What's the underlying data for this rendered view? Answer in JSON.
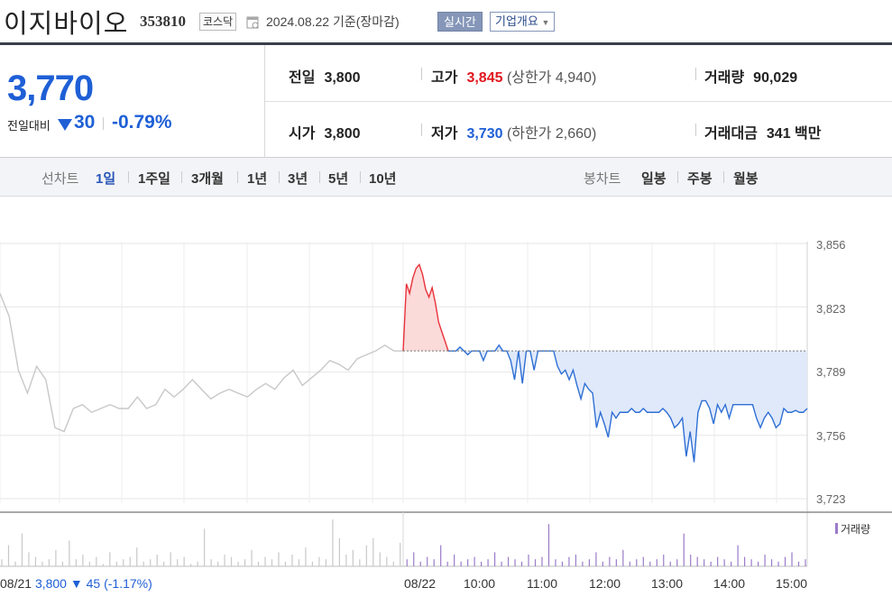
{
  "header": {
    "stock_name": "이지바이오",
    "stock_code": "353810",
    "market": "코스닥",
    "date": "2024.08.22",
    "date_suffix": "기준(장마감)",
    "realtime_label": "실시간",
    "company_info_label": "기업개요"
  },
  "quote": {
    "price": "3,770",
    "change_label": "전일대비",
    "change_value": "30",
    "change_pct": "-0.79%",
    "prev_close_label": "전일",
    "prev_close": "3,800",
    "open_label": "시가",
    "open": "3,800",
    "high_label": "고가",
    "high": "3,845",
    "upper_limit_label": "(상한가",
    "upper_limit": "4,940)",
    "low_label": "저가",
    "low": "3,730",
    "lower_limit_label": "(하한가",
    "lower_limit": "2,660)",
    "volume_label": "거래량",
    "volume": "90,029",
    "amount_label": "거래대금",
    "amount": "341 백만"
  },
  "period_bar": {
    "line_chart_label": "선차트",
    "periods": [
      "1일",
      "1주일",
      "3개월",
      "1년",
      "3년",
      "5년",
      "10년"
    ],
    "active_period": "1일",
    "candle_chart_label": "봉차트",
    "candles": [
      "일봉",
      "주봉",
      "월봉"
    ]
  },
  "chart_data": {
    "type": "line",
    "y_ticks": [
      "3,856",
      "3,823",
      "3,789",
      "3,756",
      "3,723"
    ],
    "ylim": [
      3720,
      3860
    ],
    "reference_price": 3800,
    "x_ticks": [
      "08/22",
      "10:00",
      "11:00",
      "12:00",
      "13:00",
      "14:00",
      "15:00"
    ],
    "volume_legend": "거래량",
    "prev_day": {
      "label": "08/21",
      "close": "3,800",
      "change": "▼ 45",
      "pct": "(-1.17%)"
    },
    "colors": {
      "up": "#e8323a",
      "down": "#2e6fd4",
      "prev": "#c8c8c8",
      "fill_up": "#fbdada",
      "fill_down": "#dfe9fa",
      "volume": "#9a7bc9"
    },
    "series": [
      {
        "values_prev": [
          3830,
          3818,
          3790,
          3778,
          3792,
          3785,
          3760,
          3758,
          3770,
          3772,
          3768,
          3770,
          3772,
          3770,
          3770,
          3776,
          3770,
          3772,
          3780,
          3776,
          3780,
          3785,
          3780,
          3775,
          3778,
          3780,
          3778,
          3776,
          3780,
          3783,
          3780,
          3786,
          3790,
          3782,
          3786,
          3790,
          3795,
          3793,
          3790,
          3796,
          3798,
          3800,
          3803,
          3800,
          3800
        ],
        "values_up": [
          3800,
          3835,
          3830,
          3838,
          3843,
          3845,
          3840,
          3832,
          3828,
          3833,
          3825,
          3815,
          3810,
          3805,
          3800
        ],
        "values_day": [
          3800,
          3800,
          3800,
          3802,
          3800,
          3798,
          3800,
          3800,
          3800,
          3795,
          3800,
          3800,
          3800,
          3803,
          3800,
          3800,
          3795,
          3785,
          3800,
          3783,
          3800,
          3800,
          3790,
          3800,
          3800,
          3800,
          3800,
          3800,
          3792,
          3788,
          3790,
          3785,
          3790,
          3782,
          3775,
          3783,
          3780,
          3778,
          3760,
          3768,
          3762,
          3755,
          3768,
          3765,
          3768,
          3768,
          3768,
          3770,
          3768,
          3768,
          3770,
          3768,
          3768,
          3768,
          3768,
          3770,
          3768,
          3765,
          3760,
          3762,
          3765,
          3745,
          3758,
          3742,
          3768,
          3774,
          3774,
          3770,
          3762,
          3772,
          3768,
          3772,
          3765,
          3772,
          3772,
          3772,
          3772,
          3772,
          3772,
          3765,
          3760,
          3765,
          3768,
          3765,
          3760,
          3762,
          3770,
          3768,
          3768,
          3769,
          3768,
          3768,
          3770
        ]
      }
    ],
    "volume": [
      3,
      9,
      2,
      14,
      6,
      4,
      2,
      3,
      7,
      2,
      11,
      3,
      5,
      2,
      4,
      1,
      6,
      2,
      3,
      4,
      8,
      2,
      3,
      5,
      2,
      6,
      3,
      4,
      1,
      2,
      16,
      3,
      2,
      5,
      4,
      2,
      3,
      7,
      2,
      4,
      3,
      6,
      2,
      5,
      3,
      8,
      2,
      4,
      3,
      20,
      12,
      5,
      7,
      3,
      9,
      12,
      6,
      4,
      2,
      10,
      3,
      6,
      2,
      4,
      3,
      9,
      2,
      5,
      2,
      3,
      4,
      2,
      3,
      6,
      2,
      4,
      3,
      2,
      5,
      3,
      4,
      18,
      3,
      2,
      4,
      5,
      2,
      3,
      6,
      2,
      4,
      3,
      7,
      2,
      3,
      4,
      2,
      3,
      5,
      2,
      3,
      14,
      5,
      4,
      3,
      2,
      4,
      3,
      2,
      9,
      4,
      3,
      2,
      5,
      3,
      2,
      4,
      6,
      2,
      3
    ]
  }
}
